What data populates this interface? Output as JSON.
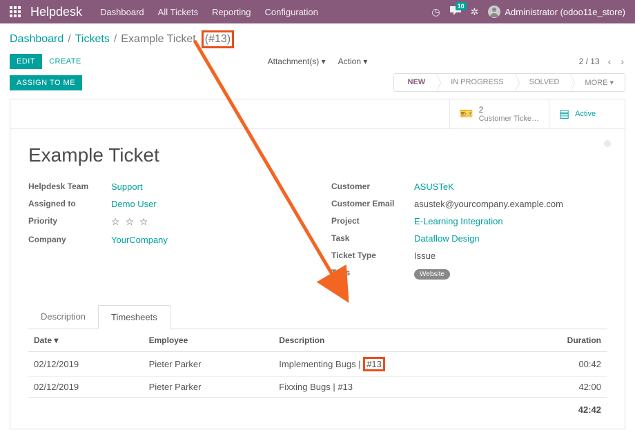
{
  "topnav": {
    "brand": "Helpdesk",
    "links": [
      "Dashboard",
      "All Tickets",
      "Reporting",
      "Configuration"
    ],
    "msg_count": "10",
    "user_label": "Administrator (odoo11e_store)"
  },
  "breadcrumbs": {
    "dashboard": "Dashboard",
    "tickets": "Tickets",
    "current_prefix": "Example Ticket",
    "current_id": "(#13)"
  },
  "buttons": {
    "edit": "EDIT",
    "create": "CREATE",
    "attachments": "Attachment(s) ▾",
    "action": "Action ▾",
    "assign": "ASSIGN TO ME"
  },
  "pager": {
    "text": "2 / 13"
  },
  "status": {
    "items": [
      "NEW",
      "IN PROGRESS",
      "SOLVED",
      "MORE ▾"
    ],
    "active_index": 0
  },
  "statbox": {
    "tickets_count": "2",
    "tickets_label": "Customer Ticke…",
    "active_label": "Active"
  },
  "title": "Example Ticket",
  "left_fields": {
    "helpdesk_team": {
      "label": "Helpdesk Team",
      "value": "Support"
    },
    "assigned_to": {
      "label": "Assigned to",
      "value": "Demo User"
    },
    "priority": {
      "label": "Priority",
      "value": "☆ ☆ ☆"
    },
    "company": {
      "label": "Company",
      "value": "YourCompany"
    }
  },
  "right_fields": {
    "customer": {
      "label": "Customer",
      "value": "ASUSTeK"
    },
    "customer_email": {
      "label": "Customer Email",
      "value": "asustek@yourcompany.example.com"
    },
    "project": {
      "label": "Project",
      "value": "E-Learning Integration"
    },
    "task": {
      "label": "Task",
      "value": "Dataflow Design"
    },
    "ticket_type": {
      "label": "Ticket Type",
      "value": "Issue"
    },
    "tags": {
      "label": "Tags",
      "value": "Website"
    }
  },
  "tabs": {
    "description": "Description",
    "timesheets": "Timesheets"
  },
  "table": {
    "headers": {
      "date": "Date ▾",
      "employee": "Employee",
      "description": "Description",
      "duration": "Duration"
    },
    "rows": [
      {
        "date": "02/12/2019",
        "employee": "Pieter Parker",
        "description_text": "Implementing Bugs |",
        "description_id": "#13",
        "duration": "00:42"
      },
      {
        "date": "02/12/2019",
        "employee": "Pieter Parker",
        "description_text": "Fixxing Bugs | #13",
        "description_id": "",
        "duration": "42:00"
      }
    ],
    "total": "42:42"
  }
}
